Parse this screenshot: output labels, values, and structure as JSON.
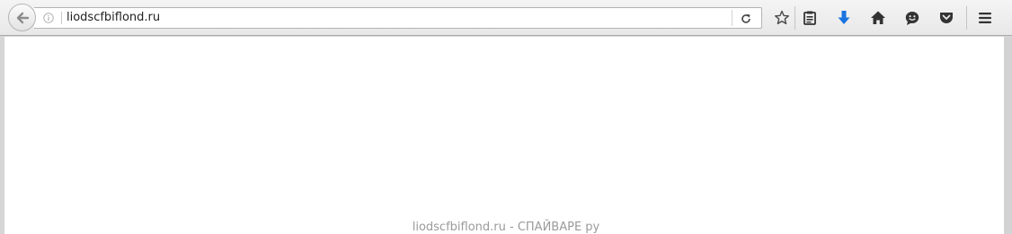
{
  "browser": {
    "url": "liodscfbiflond.ru",
    "toolbar_icons": [
      "back-arrow-icon",
      "site-info-icon",
      "reload-icon",
      "bookmark-star-icon",
      "reading-list-icon",
      "downloads-icon",
      "home-icon",
      "hello-chat-icon",
      "pocket-icon",
      "menu-hamburger-icon"
    ],
    "accent_color": "#1a74e0"
  },
  "page": {
    "watermark": "liodscfbiflond.ru - СПАЙВАРЕ ру"
  }
}
